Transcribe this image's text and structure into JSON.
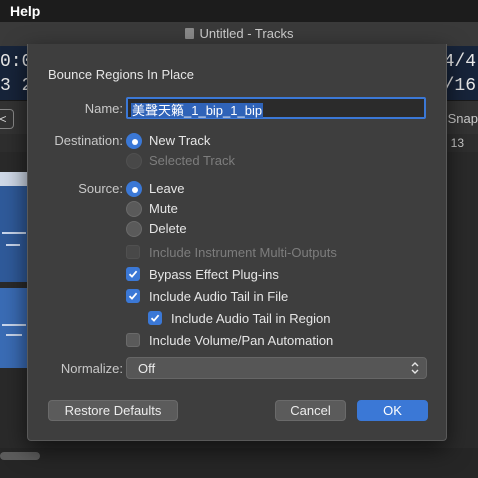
{
  "menubar": {
    "help": "Help"
  },
  "window": {
    "title": "Untitled - Tracks"
  },
  "lcd": {
    "left_top": "0:0",
    "left_bottom": "3 2",
    "right_top": "4/4",
    "right_bottom": "/16"
  },
  "tracks": {
    "left_button": "<",
    "snap_label": "Snap",
    "ruler_number": "13"
  },
  "dialog": {
    "title": "Bounce Regions In Place",
    "name_label": "Name:",
    "name_value": "美聲天籟_1_bip_1_bip",
    "destination_label": "Destination:",
    "destination_options": [
      {
        "label": "New Track",
        "selected": true,
        "enabled": true
      },
      {
        "label": "Selected Track",
        "selected": false,
        "enabled": false
      }
    ],
    "source_label": "Source:",
    "source_options": [
      {
        "label": "Leave",
        "selected": true
      },
      {
        "label": "Mute",
        "selected": false
      },
      {
        "label": "Delete",
        "selected": false
      }
    ],
    "checkboxes": [
      {
        "label": "Include Instrument Multi-Outputs",
        "checked": false,
        "enabled": false
      },
      {
        "label": "Bypass Effect Plug-ins",
        "checked": true,
        "enabled": true
      },
      {
        "label": "Include Audio Tail in File",
        "checked": true,
        "enabled": true
      },
      {
        "label": "Include Audio Tail in Region",
        "checked": true,
        "enabled": true
      },
      {
        "label": "Include Volume/Pan Automation",
        "checked": false,
        "enabled": true
      }
    ],
    "normalize_label": "Normalize:",
    "normalize_value": "Off",
    "buttons": {
      "restore": "Restore Defaults",
      "cancel": "Cancel",
      "ok": "OK"
    },
    "accent_color": "#3b78d6"
  }
}
